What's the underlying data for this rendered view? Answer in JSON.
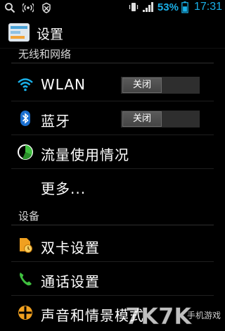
{
  "status_bar": {
    "battery_percent": "53%",
    "time": "17:31",
    "accent_color": "#1ab0e8",
    "icons": [
      "search-icon",
      "hotspot-icon",
      "shield-off-icon",
      "vibrate-icon",
      "signal-icon",
      "battery-icon"
    ]
  },
  "app_bar": {
    "title": "设置"
  },
  "sections": {
    "wireless": {
      "title": "无线和网络"
    },
    "device": {
      "title": "设备"
    }
  },
  "items": {
    "wlan": {
      "label": "WLAN",
      "toggle": "关闭",
      "icon": "wifi-icon"
    },
    "bluetooth": {
      "label": "蓝牙",
      "toggle": "关闭",
      "icon": "bluetooth-icon"
    },
    "data_usage": {
      "label": "流量使用情况",
      "icon": "data-usage-icon"
    },
    "more": {
      "label": "更多..."
    },
    "dual_sim": {
      "label": "双卡设置",
      "icon": "sim-card-icon"
    },
    "call": {
      "label": "通话设置",
      "icon": "phone-icon"
    },
    "sound": {
      "label": "声音和情景模式",
      "icon": "sound-profile-icon"
    }
  },
  "watermark": {
    "text": "7K7K",
    "subtext": "手机游戏"
  }
}
